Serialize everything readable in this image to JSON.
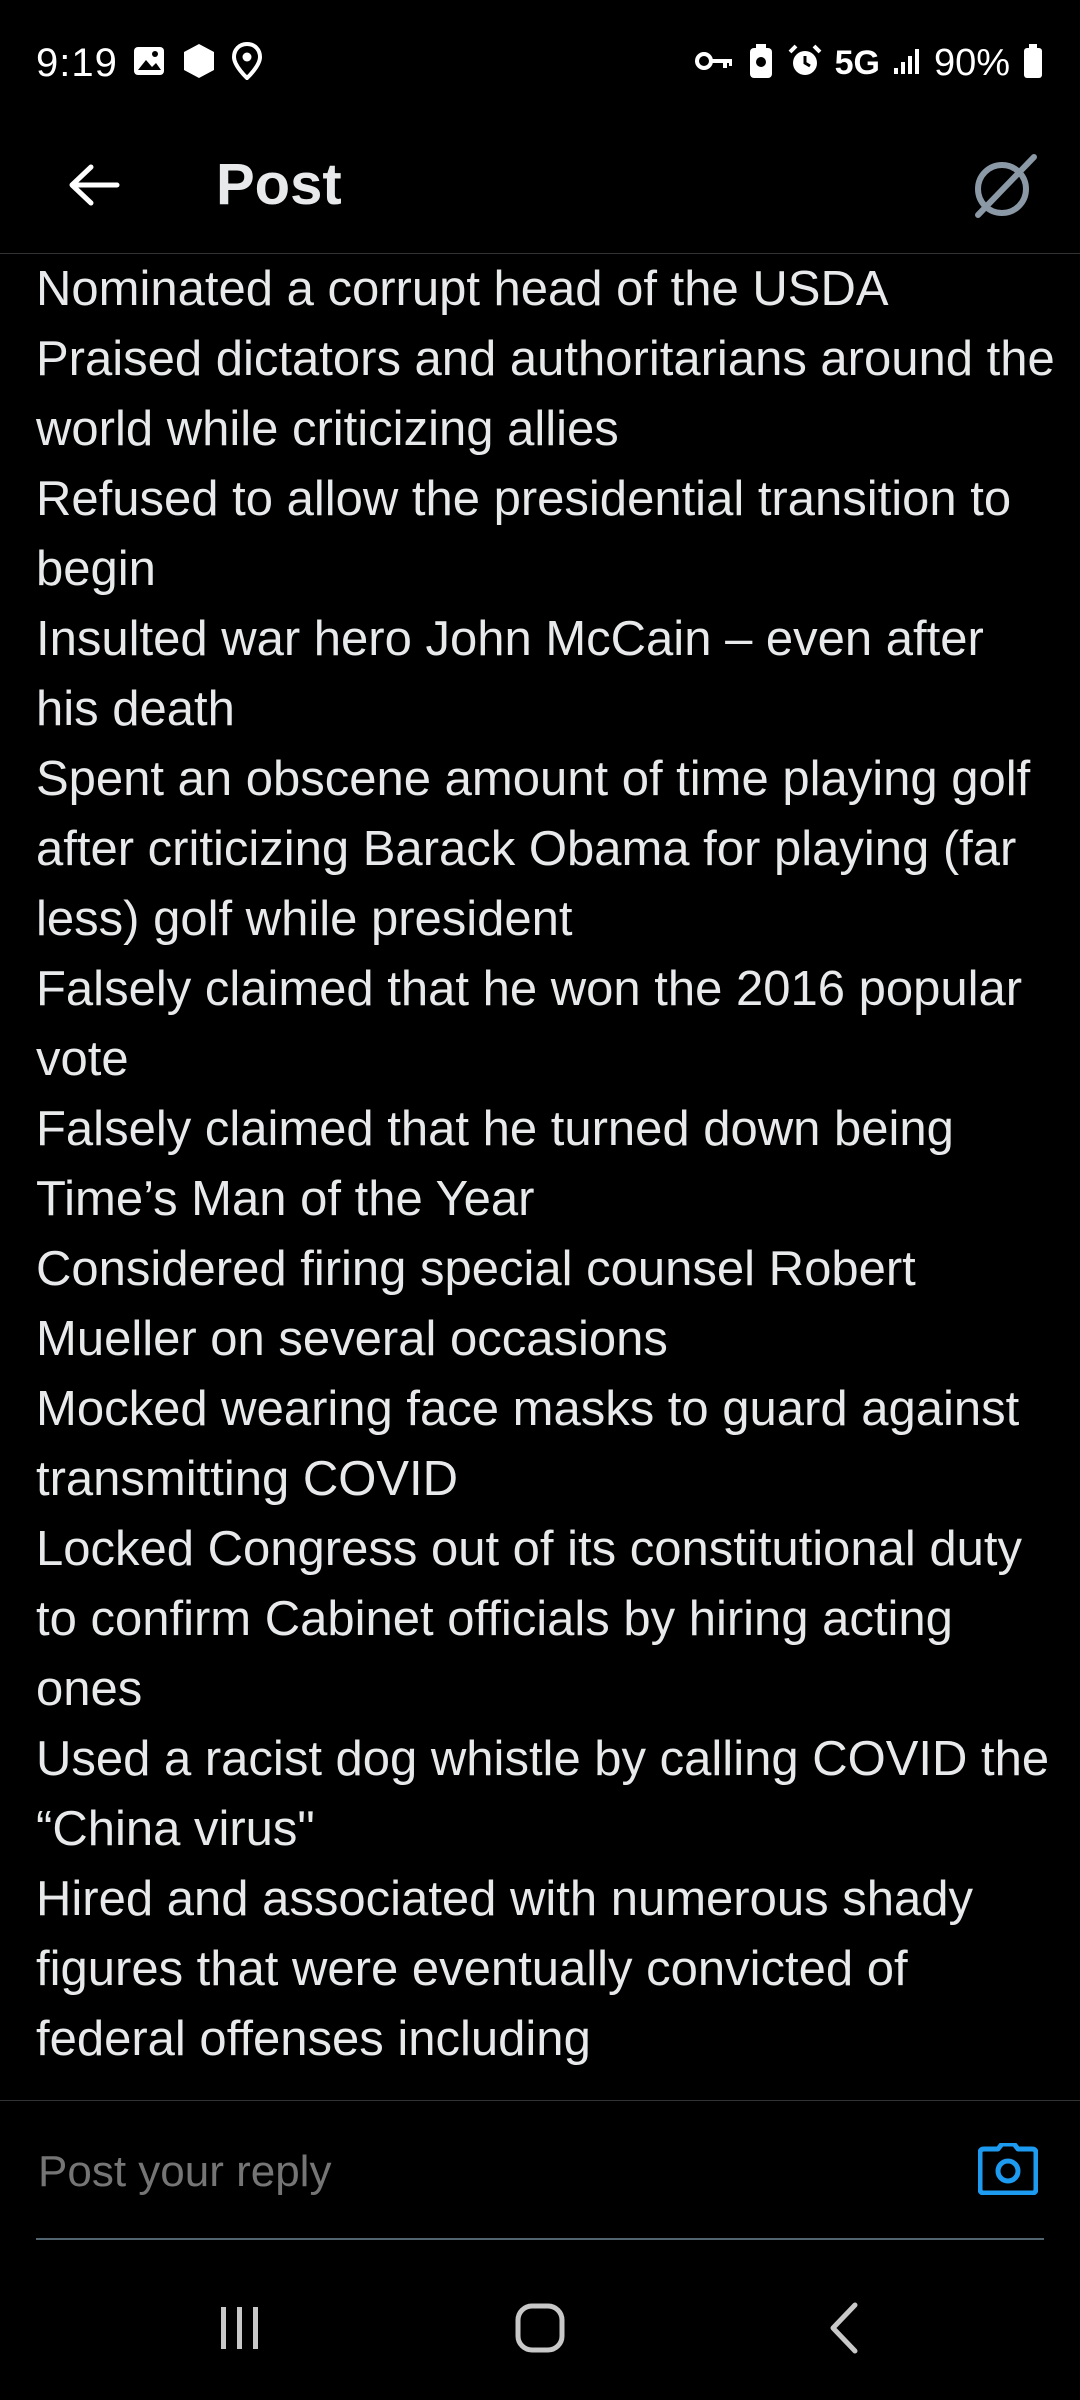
{
  "status_bar": {
    "time": "9:19",
    "network": "5G",
    "battery": "90%"
  },
  "header": {
    "title": "Post"
  },
  "post": {
    "lines": [
      "Nominated a corrupt head of the USDA",
      "Praised dictators and authoritarians around the world while criticizing allies",
      "Refused to allow the presidential transition to begin",
      "Insulted war hero John McCain – even after his death",
      "Spent an obscene amount of time playing golf after criticizing Barack Obama for playing (far less) golf while president",
      "Falsely claimed that he won the 2016 popular vote",
      "Falsely claimed that he turned down being Time’s Man of the Year",
      "Considered firing special counsel Robert Mueller on several occasions",
      "Mocked wearing face masks to guard against transmitting COVID",
      "Locked Congress out of its constitutional duty to confirm Cabinet officials by hiring acting ones",
      "Used a racist dog whistle by calling COVID the “China virus\"",
      "Hired and associated with numerous shady figures that were eventually convicted of federal offenses including"
    ]
  },
  "reply": {
    "placeholder": "Post your reply"
  },
  "colors": {
    "background": "#000000",
    "text": "#e7e9ea",
    "muted": "#71767b",
    "accent": "#1d9bf0"
  },
  "icons": {
    "back": "arrow-left-icon",
    "grok": "grok-icon",
    "camera": "camera-icon",
    "recents": "recents-icon",
    "home": "home-icon",
    "nav_back": "chevron-left-icon"
  }
}
